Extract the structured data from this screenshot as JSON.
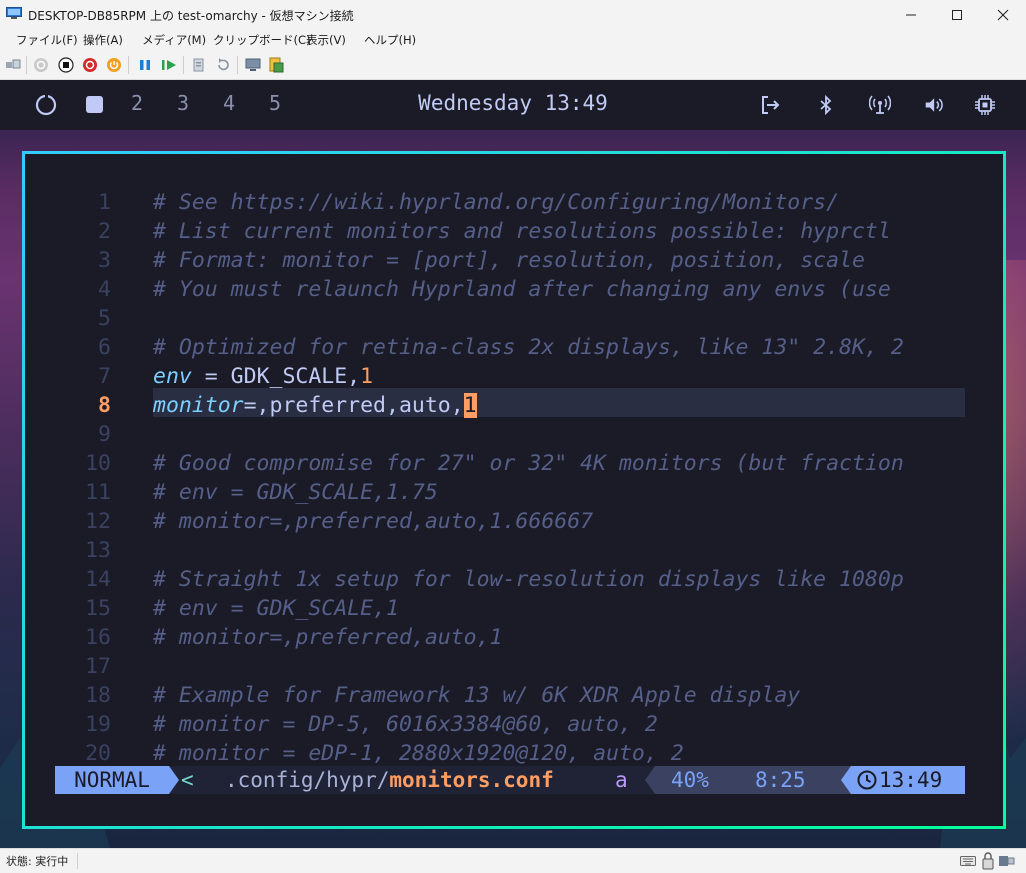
{
  "window": {
    "title": "DESKTOP-DB85RPM 上の test-omarchy - 仮想マシン接続",
    "minimize_icon": "minimize-icon",
    "maximize_icon": "maximize-icon",
    "close_icon": "close-icon"
  },
  "menubar": {
    "items": [
      "ファイル(F)",
      "操作(A)",
      "メディア(M)",
      "クリップボード(C)",
      "表示(V)",
      "ヘルプ(H)"
    ]
  },
  "toolbar": {
    "icons": [
      "ctrl-alt-del-icon",
      "start-icon",
      "turn-off-icon",
      "shutdown-icon",
      "save-state-icon",
      "pause-icon",
      "resume-icon",
      "checkpoint-icon",
      "revert-icon",
      "enhanced-session-icon",
      "share-icon"
    ]
  },
  "waybar": {
    "workspaces": [
      "2",
      "3",
      "4",
      "5"
    ],
    "clock": "Wednesday 13:49",
    "icons": [
      "omarchy-logo-icon",
      "active-workspace-icon",
      "logout-icon",
      "bluetooth-icon",
      "network-icon",
      "volume-icon",
      "cpu-icon"
    ]
  },
  "editor": {
    "lines": [
      {
        "n": "1",
        "text": "# See https://wiki.hyprland.org/Configuring/Monitors/"
      },
      {
        "n": "2",
        "text": "# List current monitors and resolutions possible: hyprctl"
      },
      {
        "n": "3",
        "text": "# Format: monitor = [port], resolution, position, scale"
      },
      {
        "n": "4",
        "text": "# You must relaunch Hyprland after changing any envs (use"
      },
      {
        "n": "5",
        "text": ""
      },
      {
        "n": "6",
        "text": "# Optimized for retina-class 2x displays, like 13\" 2.8K, 2"
      },
      {
        "n": "7",
        "text": "env = GDK_SCALE,1"
      },
      {
        "n": "8",
        "text": "monitor=,preferred,auto,1"
      },
      {
        "n": "9",
        "text": ""
      },
      {
        "n": "10",
        "text": "# Good compromise for 27\" or 32\" 4K monitors (but fraction"
      },
      {
        "n": "11",
        "text": "# env = GDK_SCALE,1.75"
      },
      {
        "n": "12",
        "text": "# monitor=,preferred,auto,1.666667"
      },
      {
        "n": "13",
        "text": ""
      },
      {
        "n": "14",
        "text": "# Straight 1x setup for low-resolution displays like 1080p"
      },
      {
        "n": "15",
        "text": "# env = GDK_SCALE,1"
      },
      {
        "n": "16",
        "text": "# monitor=,preferred,auto,1"
      },
      {
        "n": "17",
        "text": ""
      },
      {
        "n": "18",
        "text": "# Example for Framework 13 w/ 6K XDR Apple display"
      },
      {
        "n": "19",
        "text": "# monitor = DP-5, 6016x3384@60, auto, 2"
      },
      {
        "n": "20",
        "text": "# monitor = eDP-1, 2880x1920@120, auto, 2"
      }
    ],
    "line7": {
      "key": "env",
      "mid": " = GDK_SCALE,",
      "val": "1"
    },
    "line8": {
      "key": "monitor",
      "mid": "=,preferred,auto,",
      "val": "1"
    }
  },
  "statusline": {
    "mode": "NORMAL",
    "arrow": "<",
    "path": ".config/hypr/",
    "file": "monitors.conf",
    "flag": "a",
    "percent": "40%",
    "position": "8:25",
    "clock": "13:49",
    "clock_icon": "clock-icon"
  },
  "statusbar": {
    "text": "状態: 実行中",
    "icons": [
      "keyboard-icon",
      "lock-icon",
      "usb-icon"
    ]
  },
  "colors": {
    "accent": "#7aa2f7",
    "comment": "#565f89",
    "number": "#ff9e64",
    "keyword": "#7dcfff",
    "border_start": "#33ccff",
    "border_end": "#00ff99"
  }
}
